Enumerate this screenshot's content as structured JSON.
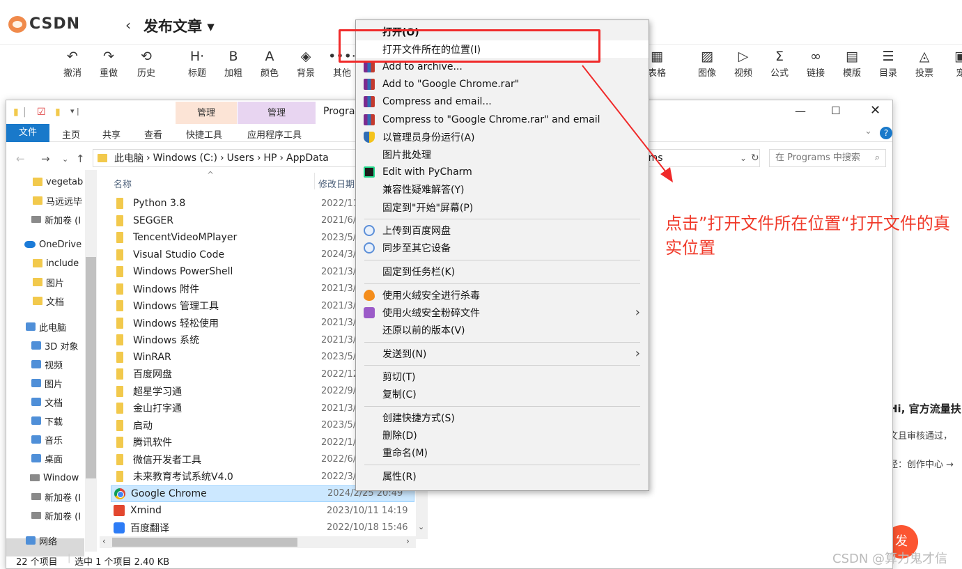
{
  "csdn": {
    "logo_text": "CSDN",
    "back_symbol": "‹",
    "title": "发布文章 ▾",
    "toolbar": [
      {
        "icon": "↶",
        "label": "撤消"
      },
      {
        "icon": "↷",
        "label": "重做"
      },
      {
        "icon": "⟲",
        "label": "历史"
      },
      {
        "icon": "H·",
        "label": "标题"
      },
      {
        "icon": "B",
        "label": "加粗"
      },
      {
        "icon": "A",
        "label": "颜色"
      },
      {
        "icon": "◈",
        "label": "背景"
      },
      {
        "icon": "•••·",
        "label": "其他"
      },
      {
        "icon": "▦",
        "label": "表格"
      },
      {
        "icon": "▨",
        "label": "图像"
      },
      {
        "icon": "▷",
        "label": "视频"
      },
      {
        "icon": "Σ",
        "label": "公式"
      },
      {
        "icon": "∞",
        "label": "链接"
      },
      {
        "icon": "▤",
        "label": "模版"
      },
      {
        "icon": "☰",
        "label": "目录"
      },
      {
        "icon": "◬",
        "label": "投票"
      },
      {
        "icon": "▣",
        "label": "宠"
      }
    ],
    "side_title": "Hi, 官方流量扶",
    "side_line1": "文且审核通过，",
    "side_line2": "径：创作中心 →",
    "publish_label": "发",
    "watermark": "CSDN @算力鬼才信"
  },
  "explorer": {
    "context_tab_1": "管理",
    "context_tab_2": "管理",
    "window_title": "Progra",
    "ribbon_tabs": [
      "文件",
      "主页",
      "共享",
      "查看",
      "快捷工具",
      "应用程序工具"
    ],
    "address": [
      "此电脑",
      "Windows (C:)",
      "Users",
      "HP",
      "AppData"
    ],
    "address_tail": "ams",
    "search_placeholder": "在 Programs 中搜索",
    "nav_items": [
      {
        "label": "vegetab",
        "icon": "folder"
      },
      {
        "label": "马远远毕",
        "icon": "folder"
      },
      {
        "label": "新加卷 (I",
        "icon": "drive"
      },
      {
        "label": "OneDrive",
        "icon": "onedrive"
      },
      {
        "label": "include",
        "icon": "folder"
      },
      {
        "label": "图片",
        "icon": "folder"
      },
      {
        "label": "文档",
        "icon": "folder"
      },
      {
        "label": "此电脑",
        "icon": "pc"
      },
      {
        "label": "3D 对象",
        "icon": "pc"
      },
      {
        "label": "视频",
        "icon": "pc"
      },
      {
        "label": "图片",
        "icon": "pc"
      },
      {
        "label": "文档",
        "icon": "pc"
      },
      {
        "label": "下载",
        "icon": "pc"
      },
      {
        "label": "音乐",
        "icon": "pc"
      },
      {
        "label": "桌面",
        "icon": "pc"
      },
      {
        "label": "Window",
        "icon": "drive"
      },
      {
        "label": "新加卷 (I",
        "icon": "drive"
      },
      {
        "label": "新加卷 (I",
        "icon": "drive"
      },
      {
        "label": "网络",
        "icon": "pc"
      }
    ],
    "col_name": "名称",
    "col_date": "修改日期",
    "files": [
      {
        "name": "Python 3.8",
        "date": "2022/11",
        "kind": "folder"
      },
      {
        "name": "SEGGER",
        "date": "2021/6/",
        "kind": "folder"
      },
      {
        "name": "TencentVideoMPlayer",
        "date": "2023/5/",
        "kind": "folder"
      },
      {
        "name": "Visual Studio Code",
        "date": "2024/3/",
        "kind": "folder"
      },
      {
        "name": "Windows PowerShell",
        "date": "2021/3/",
        "kind": "folder"
      },
      {
        "name": "Windows 附件",
        "date": "2021/3/",
        "kind": "folder"
      },
      {
        "name": "Windows 管理工具",
        "date": "2021/3/",
        "kind": "folder"
      },
      {
        "name": "Windows 轻松使用",
        "date": "2021/3/",
        "kind": "folder"
      },
      {
        "name": "Windows 系统",
        "date": "2021/3/",
        "kind": "folder"
      },
      {
        "name": "WinRAR",
        "date": "2023/5/",
        "kind": "folder"
      },
      {
        "name": "百度网盘",
        "date": "2022/12",
        "kind": "folder"
      },
      {
        "name": "超星学习通",
        "date": "2022/9/",
        "kind": "folder"
      },
      {
        "name": "金山打字通",
        "date": "2021/3/",
        "kind": "folder"
      },
      {
        "name": "启动",
        "date": "2023/5/",
        "kind": "folder"
      },
      {
        "name": "腾讯软件",
        "date": "2022/1/",
        "kind": "folder"
      },
      {
        "name": "微信开发者工具",
        "date": "2022/6/",
        "kind": "folder"
      },
      {
        "name": "未来教育考试系统V4.0",
        "date": "2022/3/",
        "kind": "folder"
      },
      {
        "name": "Google Chrome",
        "date": "2024/2/25 20:49",
        "kind": "chrome",
        "selected": true
      },
      {
        "name": "Xmind",
        "date": "2023/10/11 14:19",
        "kind": "xmind"
      },
      {
        "name": "百度翻译",
        "date": "2022/10/18 15:46",
        "kind": "baidu"
      }
    ],
    "status_count": "22 个项目",
    "status_selected": "选中 1 个项目  2.40 KB"
  },
  "context_menu": {
    "items": [
      {
        "label": "打开(O)",
        "icon": "none",
        "bold": true
      },
      {
        "label": "打开文件所在的位置(I)",
        "icon": "none",
        "highlight": true
      },
      {
        "label": "Add to archive...",
        "icon": "rar"
      },
      {
        "label": "Add to \"Google Chrome.rar\"",
        "icon": "rar"
      },
      {
        "label": "Compress and email...",
        "icon": "rar"
      },
      {
        "label": "Compress to \"Google Chrome.rar\" and email",
        "icon": "rar"
      },
      {
        "label": "以管理员身份运行(A)",
        "icon": "shield"
      },
      {
        "label": "图片批处理",
        "icon": "none"
      },
      {
        "label": "Edit with PyCharm",
        "icon": "pycharm"
      },
      {
        "label": "兼容性疑难解答(Y)",
        "icon": "none"
      },
      {
        "label": "固定到\"开始\"屏幕(P)",
        "icon": "none",
        "sep_after": true
      },
      {
        "label": "上传到百度网盘",
        "icon": "cloud"
      },
      {
        "label": "同步至其它设备",
        "icon": "cloud",
        "sep_after": true
      },
      {
        "label": "固定到任务栏(K)",
        "icon": "none",
        "sep_after": true
      },
      {
        "label": "使用火绒安全进行杀毒",
        "icon": "fire"
      },
      {
        "label": "使用火绒安全粉碎文件",
        "icon": "shred",
        "submenu": true
      },
      {
        "label": "还原以前的版本(V)",
        "icon": "none",
        "sep_after": true
      },
      {
        "label": "发送到(N)",
        "icon": "none",
        "submenu": true,
        "sep_after": true
      },
      {
        "label": "剪切(T)",
        "icon": "none"
      },
      {
        "label": "复制(C)",
        "icon": "none",
        "sep_after": true
      },
      {
        "label": "创建快捷方式(S)",
        "icon": "none"
      },
      {
        "label": "删除(D)",
        "icon": "none"
      },
      {
        "label": "重命名(M)",
        "icon": "none",
        "sep_after": true
      },
      {
        "label": "属性(R)",
        "icon": "none"
      }
    ]
  },
  "annotation": {
    "note": "点击”打开文件所在位置“打开文件的真实位置",
    "color": "#f02a2a"
  }
}
